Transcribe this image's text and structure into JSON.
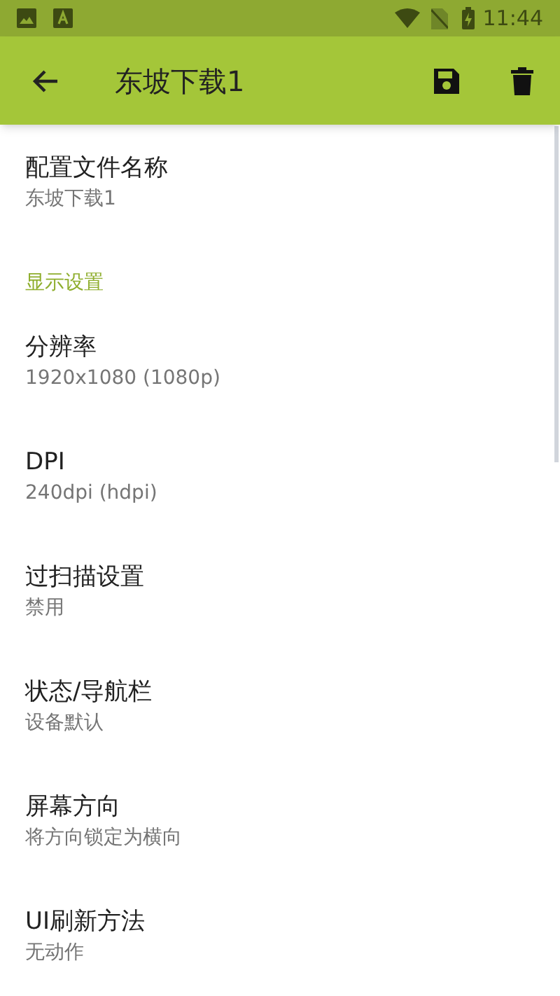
{
  "status_bar": {
    "time": "11:44"
  },
  "toolbar": {
    "title": "东坡下载1"
  },
  "settings": [
    {
      "kind": "item",
      "title": "配置文件名称",
      "summary": "东坡下载1"
    },
    {
      "kind": "header",
      "title": "显示设置"
    },
    {
      "kind": "item",
      "title": "分辨率",
      "summary": "1920x1080 (1080p)"
    },
    {
      "kind": "item",
      "title": "DPI",
      "summary": "240dpi (hdpi)"
    },
    {
      "kind": "item",
      "title": "过扫描设置",
      "summary": "禁用"
    },
    {
      "kind": "item",
      "title": "状态/导航栏",
      "summary": "设备默认"
    },
    {
      "kind": "item",
      "title": "屏幕方向",
      "summary": "将方向锁定为横向"
    },
    {
      "kind": "item",
      "title": "UI刷新方法",
      "summary": "无动作"
    }
  ]
}
